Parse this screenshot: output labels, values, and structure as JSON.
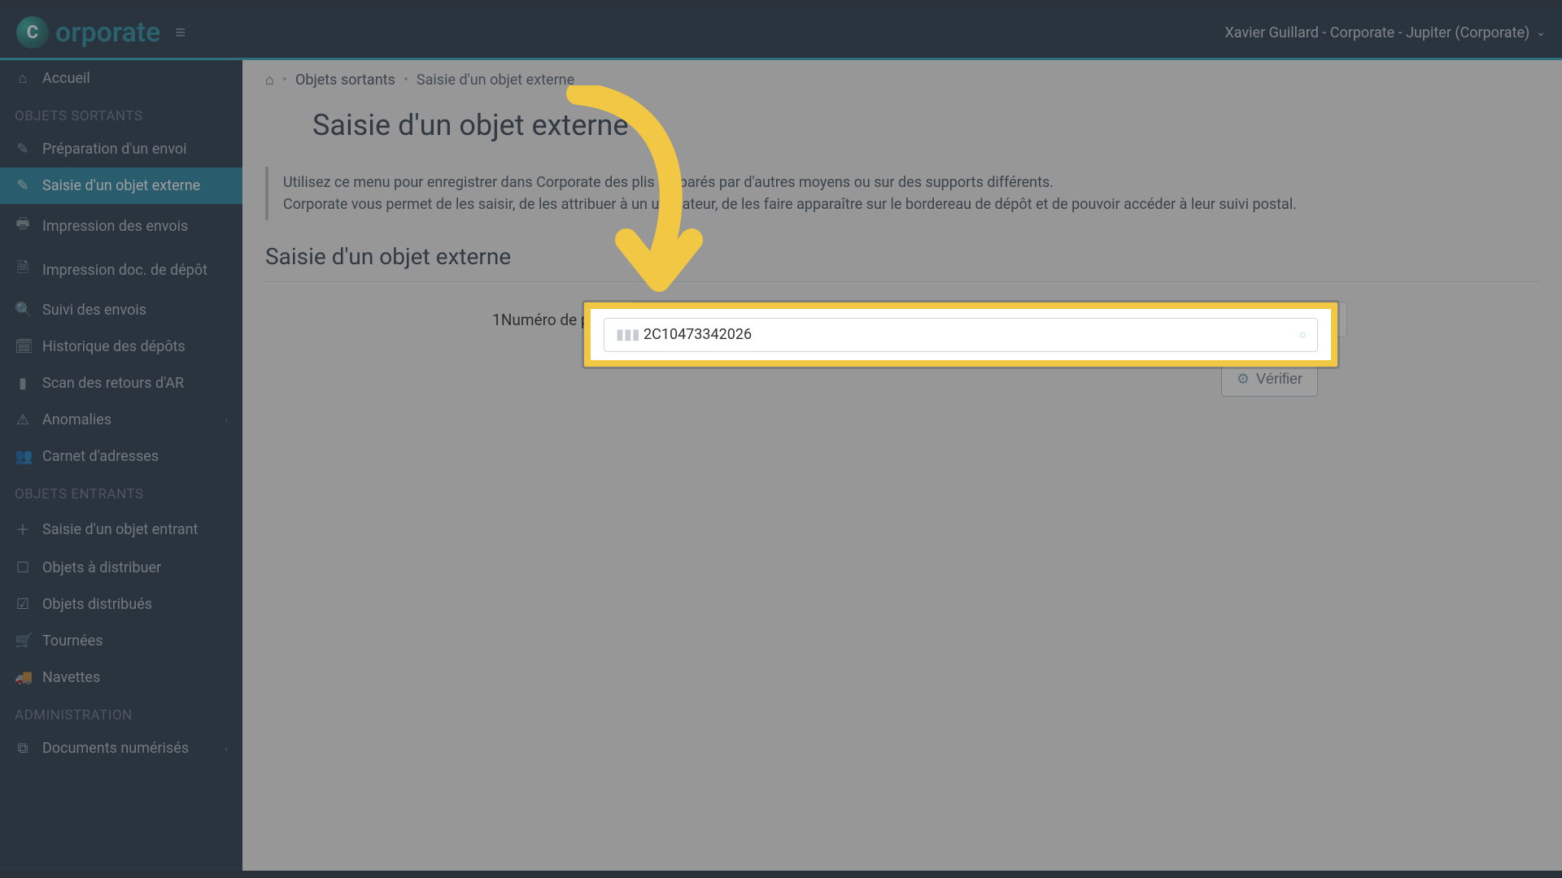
{
  "header": {
    "logo_text": "orporate",
    "logo_badge": "C",
    "user_line": "Xavier Guillard - Corporate - Jupiter (Corporate)"
  },
  "sidebar": {
    "home": "Accueil",
    "section_sortants": "OBJETS SORTANTS",
    "items_sortants": [
      {
        "icon": "✎",
        "label": "Préparation d'un envoi"
      },
      {
        "icon": "✎",
        "label": "Saisie d'un objet externe",
        "active": true
      },
      {
        "icon": "🖶",
        "label": "Impression des envois"
      },
      {
        "icon": "🗎",
        "label": "Impression doc. de dépôt"
      },
      {
        "icon": "🔍",
        "label": "Suivi des envois"
      },
      {
        "icon": "🗓",
        "label": "Historique des dépôts"
      },
      {
        "icon": "▮",
        "label": "Scan des retours d'AR"
      },
      {
        "icon": "⚠",
        "label": "Anomalies",
        "caret": true
      },
      {
        "icon": "👥",
        "label": "Carnet d'adresses"
      }
    ],
    "section_entrants": "OBJETS ENTRANTS",
    "items_entrants": [
      {
        "icon": "＋",
        "label": "Saisie d'un objet entrant"
      },
      {
        "icon": "☐",
        "label": "Objets à distribuer"
      },
      {
        "icon": "☑",
        "label": "Objets distribués"
      },
      {
        "icon": "🛒",
        "label": "Tournées"
      },
      {
        "icon": "🚚",
        "label": "Navettes"
      }
    ],
    "section_admin": "ADMINISTRATION",
    "items_admin": [
      {
        "icon": "⧉",
        "label": "Documents numérisés",
        "caret": true
      }
    ]
  },
  "breadcrumb": {
    "home_icon": "⌂",
    "level1": "Objets sortants",
    "level2": "Saisie d'un objet externe"
  },
  "page": {
    "title": "Saisie d'un objet externe",
    "info_line1": "Utilisez ce menu pour enregistrer dans Corporate des plis préparés par d'autres moyens ou sur des supports différents.",
    "info_line2": "Corporate vous permet de les saisir, de les attribuer à un utilisateur, de les faire apparaître sur le bordereau de dépôt et de pouvoir accéder à leur suivi postal.",
    "form_heading": "Saisie d'un objet externe",
    "field_label_prefix": "1",
    "field_label": "Numéro de pli",
    "field_value": "2C10473342026",
    "verify_label": "Vérifier"
  }
}
